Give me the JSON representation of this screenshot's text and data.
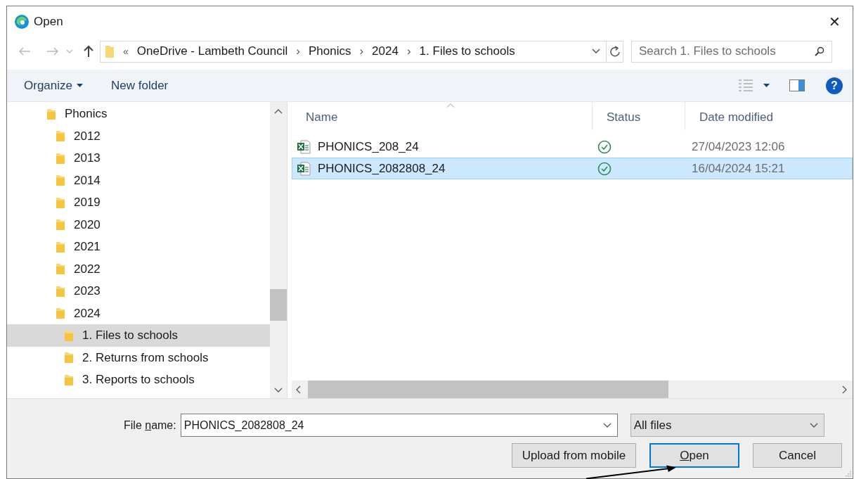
{
  "window": {
    "title": "Open",
    "close": "✕"
  },
  "address": {
    "overflow": "«",
    "crumbs": [
      "OneDrive - Lambeth Council",
      "Phonics",
      "2024",
      "1. Files to schools"
    ],
    "separator": "›"
  },
  "search": {
    "placeholder": "Search 1. Files to schools"
  },
  "toolbar": {
    "organize": "Organize",
    "new_folder": "New folder",
    "help": "?"
  },
  "tree": [
    {
      "label": "Phonics",
      "selected": false,
      "children": [
        {
          "label": "2012",
          "selected": false
        },
        {
          "label": "2013",
          "selected": false
        },
        {
          "label": "2014",
          "selected": false
        },
        {
          "label": "2019",
          "selected": false
        },
        {
          "label": "2020",
          "selected": false
        },
        {
          "label": "2021",
          "selected": false
        },
        {
          "label": "2022",
          "selected": false
        },
        {
          "label": "2023",
          "selected": false
        },
        {
          "label": "2024",
          "selected": false,
          "children": [
            {
              "label": "1. Files to schools",
              "selected": true
            },
            {
              "label": "2. Returns from schools",
              "selected": false
            },
            {
              "label": "3. Reports to schools",
              "selected": false
            }
          ]
        }
      ]
    }
  ],
  "table": {
    "columns": [
      "Name",
      "Status",
      "Date modified"
    ],
    "rows": [
      {
        "name": "PHONICS_208_24",
        "synced": true,
        "date": "27/04/2023 12:06",
        "selected": false
      },
      {
        "name": "PHONICS_2082808_24",
        "synced": true,
        "date": "16/04/2024 15:21",
        "selected": true
      }
    ]
  },
  "file_name": {
    "label_before": "File ",
    "access_key": "n",
    "label_after": "ame:",
    "value": "PHONICS_2082808_24"
  },
  "file_type": {
    "value": "All files"
  },
  "buttons": [
    {
      "kind": "plain",
      "label": "Upload from mobile"
    },
    {
      "kind": "default",
      "access_key": "O",
      "label": "pen"
    },
    {
      "kind": "plain",
      "label": "Cancel"
    }
  ]
}
